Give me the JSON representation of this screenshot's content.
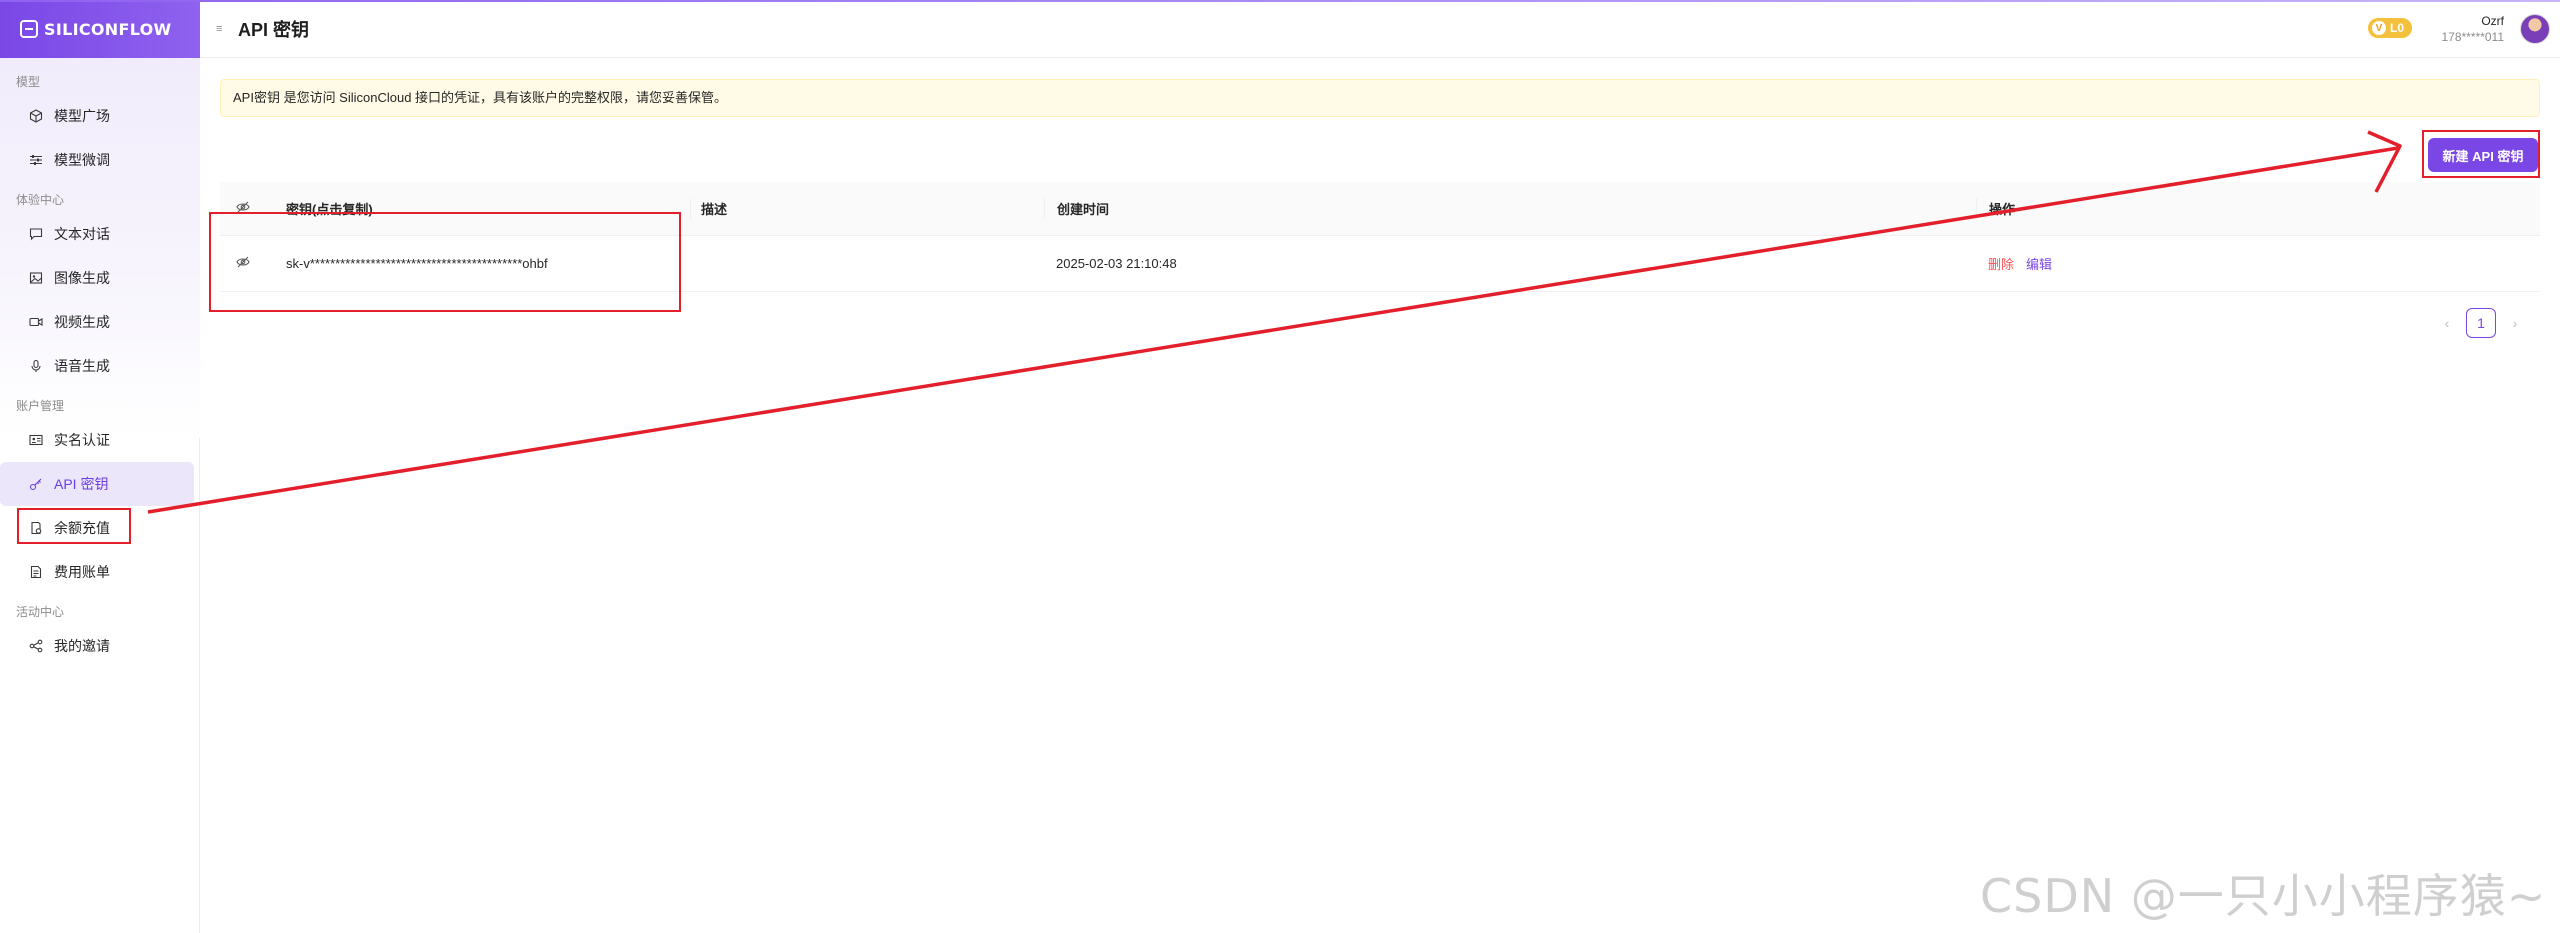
{
  "brand": {
    "name": "SILICONFLOW"
  },
  "sidebar": {
    "sections": [
      {
        "title": "模型",
        "items": [
          {
            "label": "模型广场",
            "icon": "cube-icon"
          },
          {
            "label": "模型微调",
            "icon": "sliders-icon"
          }
        ]
      },
      {
        "title": "体验中心",
        "items": [
          {
            "label": "文本对话",
            "icon": "chat-icon"
          },
          {
            "label": "图像生成",
            "icon": "image-icon"
          },
          {
            "label": "视频生成",
            "icon": "video-icon"
          },
          {
            "label": "语音生成",
            "icon": "mic-icon"
          }
        ]
      },
      {
        "title": "账户管理",
        "items": [
          {
            "label": "实名认证",
            "icon": "id-card-icon"
          },
          {
            "label": "API 密钥",
            "icon": "key-icon",
            "active": true
          },
          {
            "label": "余额充值",
            "icon": "wallet-icon"
          },
          {
            "label": "费用账单",
            "icon": "bill-icon"
          }
        ]
      },
      {
        "title": "活动中心",
        "items": [
          {
            "label": "我的邀请",
            "icon": "share-icon"
          }
        ]
      }
    ]
  },
  "header": {
    "title": "API 密钥",
    "level": "L0",
    "user_name": "Ozrf",
    "user_phone": "178*****011"
  },
  "notice": {
    "text": "API密钥 是您访问 SiliconCloud 接口的凭证，具有该账户的完整权限，请您妥善保管。"
  },
  "actions": {
    "new_key_label": "新建 API 密钥"
  },
  "table": {
    "columns": {
      "key": "密钥(点击复制)",
      "description": "描述",
      "created": "创建时间",
      "operations": "操作"
    },
    "rows": [
      {
        "key": "sk-v******************************************ohbf",
        "description": "",
        "created": "2025-02-03 21:10:48",
        "delete_label": "删除",
        "edit_label": "编辑"
      }
    ]
  },
  "pagination": {
    "current": "1"
  },
  "watermark": "CSDN @一只小小程序猿~",
  "colors": {
    "accent": "#7a47e6",
    "annotation": "#e21f2a",
    "danger": "#ff4d4f"
  }
}
